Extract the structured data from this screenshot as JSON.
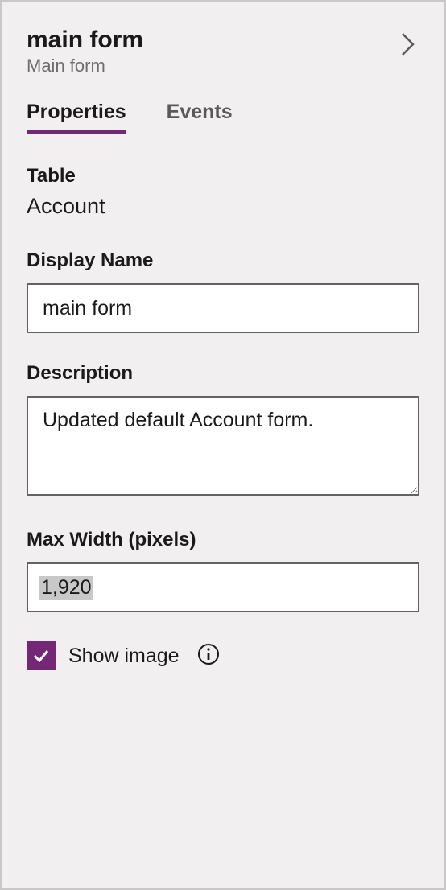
{
  "header": {
    "title": "main form",
    "subtitle": "Main form"
  },
  "tabs": {
    "properties": "Properties",
    "events": "Events"
  },
  "fields": {
    "table": {
      "label": "Table",
      "value": "Account"
    },
    "displayName": {
      "label": "Display Name",
      "value": "main form"
    },
    "description": {
      "label": "Description",
      "value": "Updated default Account form."
    },
    "maxWidth": {
      "label": "Max Width (pixels)",
      "value": "1,920"
    },
    "showImage": {
      "label": "Show image",
      "checked": true
    }
  },
  "colors": {
    "accent": "#742774"
  }
}
